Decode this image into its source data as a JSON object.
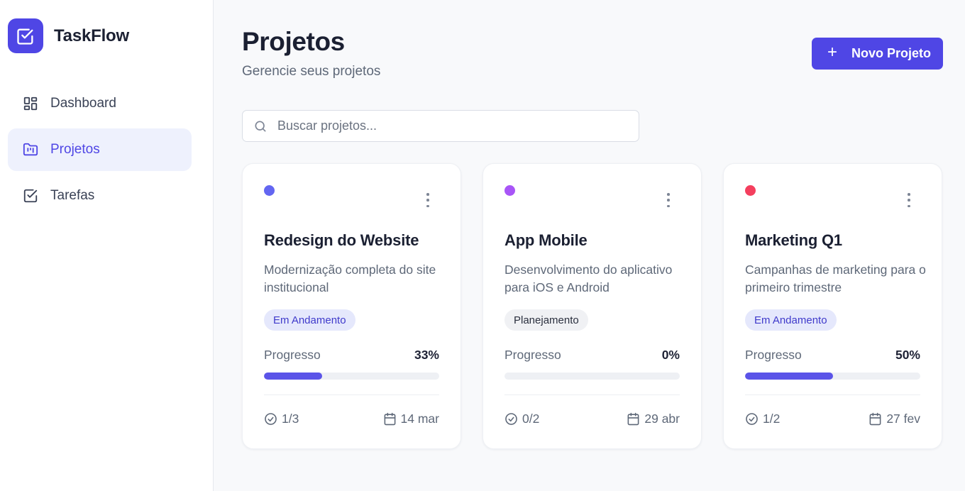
{
  "app": {
    "name": "TaskFlow",
    "accent": "#4f46e5"
  },
  "sidebar": {
    "items": [
      {
        "label": "Dashboard",
        "icon": "dashboard-grid-icon",
        "active": false
      },
      {
        "label": "Projetos",
        "icon": "folder-kanban-icon",
        "active": true
      },
      {
        "label": "Tarefas",
        "icon": "checkbox-icon",
        "active": false
      }
    ]
  },
  "header": {
    "title": "Projetos",
    "subtitle": "Gerencie seus projetos",
    "new_button": {
      "icon": "+",
      "label": "Novo Projeto"
    }
  },
  "search": {
    "placeholder": "Buscar projetos...",
    "value": ""
  },
  "projects": [
    {
      "dot_color": "#6366f1",
      "title": "Redesign do Website",
      "description": "Modernização completa do site institucional",
      "status": "Em Andamento",
      "status_bg": "#e5e8fc",
      "status_fg": "#3f3acb",
      "progress_label": "Progresso",
      "progress_text": "33%",
      "progress": 0.33,
      "tasks": "1/3",
      "due": "14 mar"
    },
    {
      "dot_color": "#a855f7",
      "title": "App Mobile",
      "description": "Desenvolvimento do aplicativo para iOS e Android",
      "status": "Planejamento",
      "status_bg": "#f0f1f4",
      "status_fg": "#2a2f3e",
      "progress_label": "Progresso",
      "progress_text": "0%",
      "progress": 0,
      "tasks": "0/2",
      "due": "29 abr"
    },
    {
      "dot_color": "#f43f5e",
      "title": "Marketing Q1",
      "description": "Campanhas de marketing para o primeiro trimestre",
      "status": "Em Andamento",
      "status_bg": "#e5e8fc",
      "status_fg": "#3f3acb",
      "progress_label": "Progresso",
      "progress_text": "50%",
      "progress": 0.5,
      "tasks": "1/2",
      "due": "27 fev"
    }
  ]
}
